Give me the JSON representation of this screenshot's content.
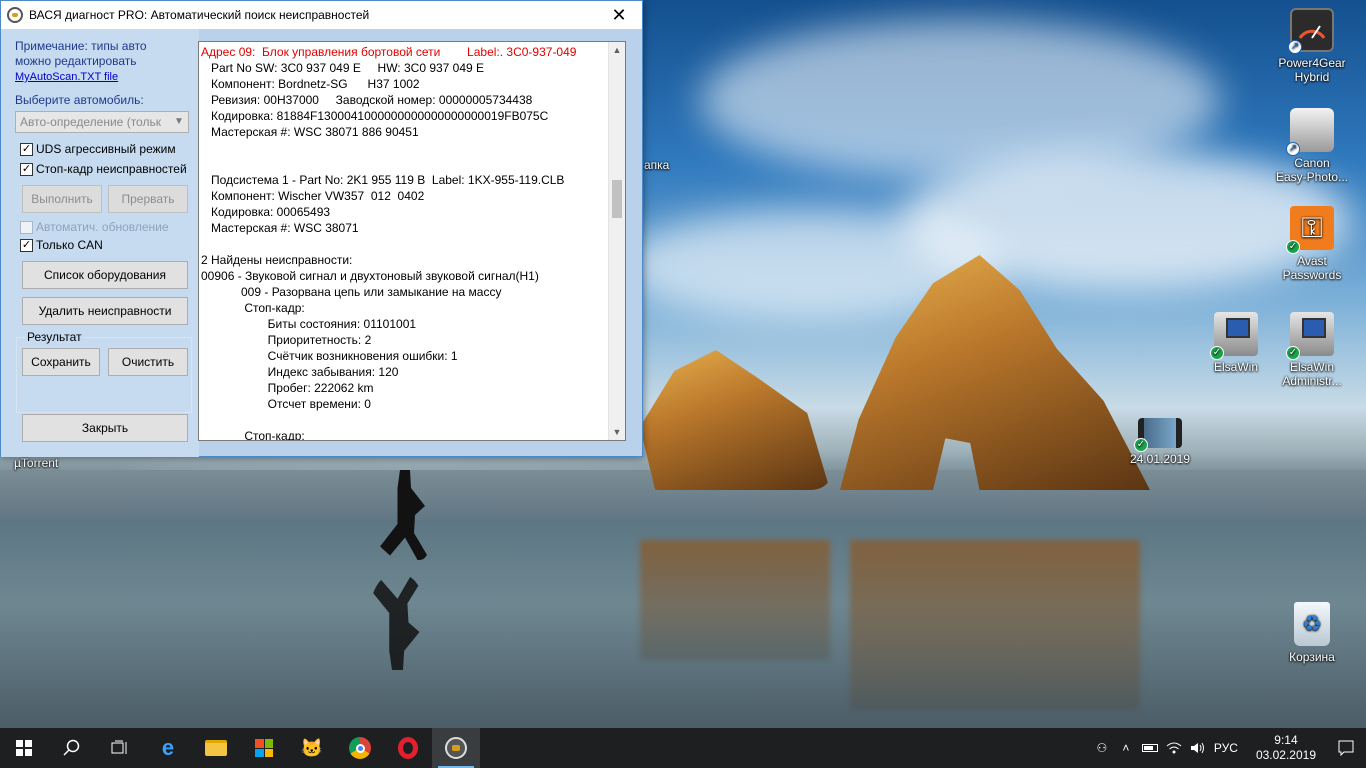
{
  "window": {
    "title": "ВАСЯ диагност PRO:  Автоматический поиск неисправностей",
    "close_glyph": "✕",
    "note_line1": "Примечание: типы авто",
    "note_line2": "можно редактировать",
    "link": "MyAutoScan.TXT file",
    "select_label": "Выберите автомобиль:",
    "select_value": "Авто-определение (тольк",
    "checkboxes": [
      {
        "label": "UDS агрессивный режим",
        "checked": true
      },
      {
        "label": "Стоп-кадр неисправностей",
        "checked": true
      },
      {
        "label": "Автоматич. обновление",
        "checked": false
      },
      {
        "label": "Только CAN",
        "checked": true
      }
    ],
    "buttons": {
      "run": "Выполнить",
      "abort": "Прервать",
      "equipment": "Список оборудования",
      "delete_faults": "Удалить неисправности",
      "save": "Сохранить",
      "clear": "Очистить",
      "close": "Закрыть"
    },
    "result_group": "Результат",
    "log": [
      {
        "text": "Адрес 09:  Блок управления бортовой сети        Label:. 3C0-937-049",
        "red": true
      },
      {
        "text": "   Part No SW: 3C0 937 049 E     HW: 3C0 937 049 E",
        "red": false
      },
      {
        "text": "   Компонент: Bordnetz-SG      H37 1002",
        "red": false
      },
      {
        "text": "   Ревизия: 00H37000     Заводской номер: 00000005734438",
        "red": false
      },
      {
        "text": "   Кодировка: 81884F1300041000000000000000000019FB075C",
        "red": false
      },
      {
        "text": "   Мастерская #: WSC 38071 886 90451",
        "red": false
      },
      {
        "text": "",
        "red": false
      },
      {
        "text": "",
        "red": false
      },
      {
        "text": "   Подсистема 1 - Part No: 2K1 955 119 B  Label: 1KX-955-119.CLB",
        "red": false
      },
      {
        "text": "   Компонент: Wischer VW357  012  0402",
        "red": false
      },
      {
        "text": "   Кодировка: 00065493",
        "red": false
      },
      {
        "text": "   Мастерская #: WSC 38071",
        "red": false
      },
      {
        "text": "",
        "red": false
      },
      {
        "text": "2 Найдены неисправности:",
        "red": false
      },
      {
        "text": "00906 - Звуковой сигнал и двухтоновый звуковой сигнал(H1)",
        "red": false
      },
      {
        "text": "            009 - Разорвана цепь или замыкание на массу",
        "red": false
      },
      {
        "text": "             Стоп-кадр:",
        "red": false
      },
      {
        "text": "                    Биты состояния: 01101001",
        "red": false
      },
      {
        "text": "                    Приоритетность: 2",
        "red": false
      },
      {
        "text": "                    Счётчик возникновения ошибки: 1",
        "red": false
      },
      {
        "text": "                    Индекс забывания: 120",
        "red": false
      },
      {
        "text": "                    Пробег: 222062 km",
        "red": false
      },
      {
        "text": "                    Отсчет времени: 0",
        "red": false
      },
      {
        "text": "",
        "red": false
      },
      {
        "text": "             Стоп-кадр:",
        "red": false
      }
    ]
  },
  "desktop": {
    "icons": [
      {
        "label1": "Power4Gear",
        "label2": "Hybrid",
        "color": "#3a3a3a"
      },
      {
        "label1": "Canon",
        "label2": "Easy-Photo...",
        "color": "#cfcfcf"
      },
      {
        "label1": "Avast",
        "label2": "Passwords",
        "color": "#f07c1e"
      },
      {
        "label1": "ElsaWin",
        "label2": "",
        "color": "#2a5db0"
      },
      {
        "label1": "ElsaWin",
        "label2": "Administr...",
        "color": "#2a5db0"
      },
      {
        "label1": "24.01.2019",
        "label2": "",
        "color": "#4a6c8a"
      },
      {
        "label1": "Корзина",
        "label2": "",
        "color": "#dfe8ef"
      }
    ],
    "partial_papka": "апка",
    "partial_utorrent": "µTorrent"
  },
  "taskbar": {
    "language": "РУС",
    "time": "9:14",
    "date": "03.02.2019"
  },
  "colors": {
    "window_bg": "#b9d1ea",
    "panel_bg": "#c6dbf0",
    "label_blue": "#1f3a8c",
    "log_red": "#e00000",
    "taskbar_bg": "#1d1f21"
  }
}
